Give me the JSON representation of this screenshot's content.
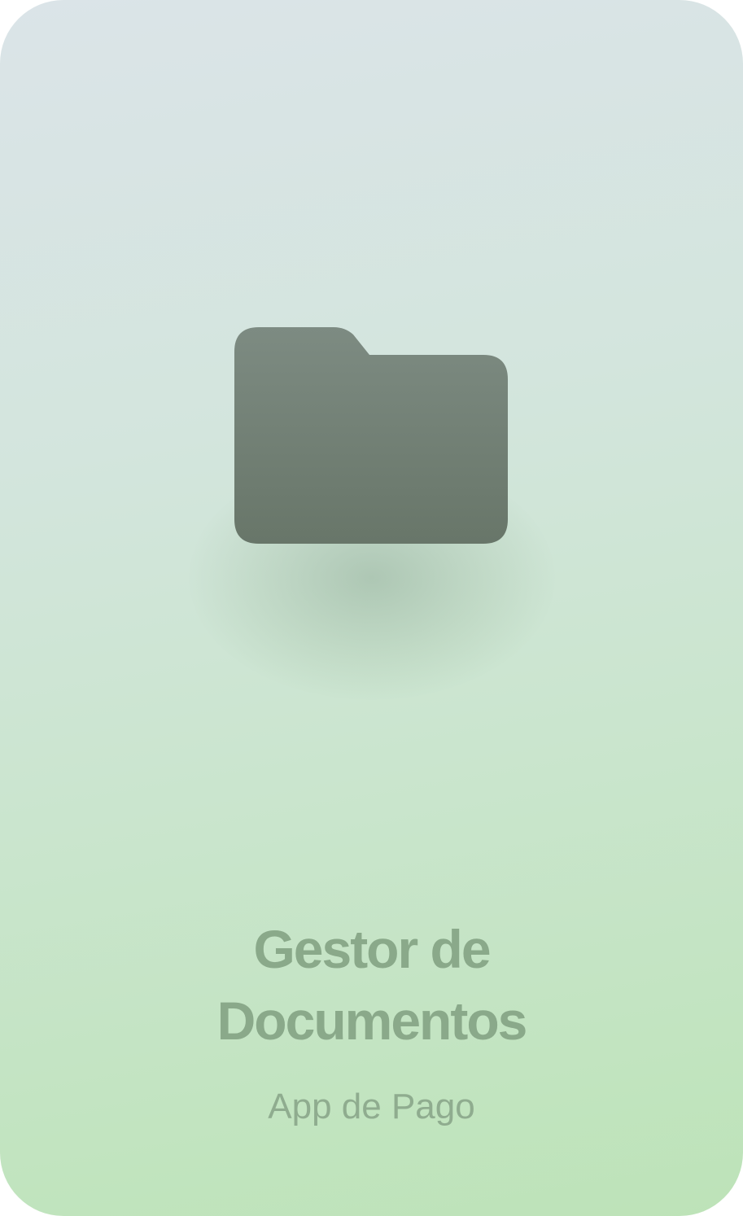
{
  "app": {
    "icon": "folder-icon",
    "title_line1": "Gestor de",
    "title_line2": "Documentos",
    "subtitle": "App de Pago"
  },
  "colors": {
    "folder": "#6f7d73",
    "title": "#8aa98a",
    "subtitle": "#8fac8f",
    "background_top": "#dbe4e8",
    "background_bottom": "#bde3b8"
  }
}
